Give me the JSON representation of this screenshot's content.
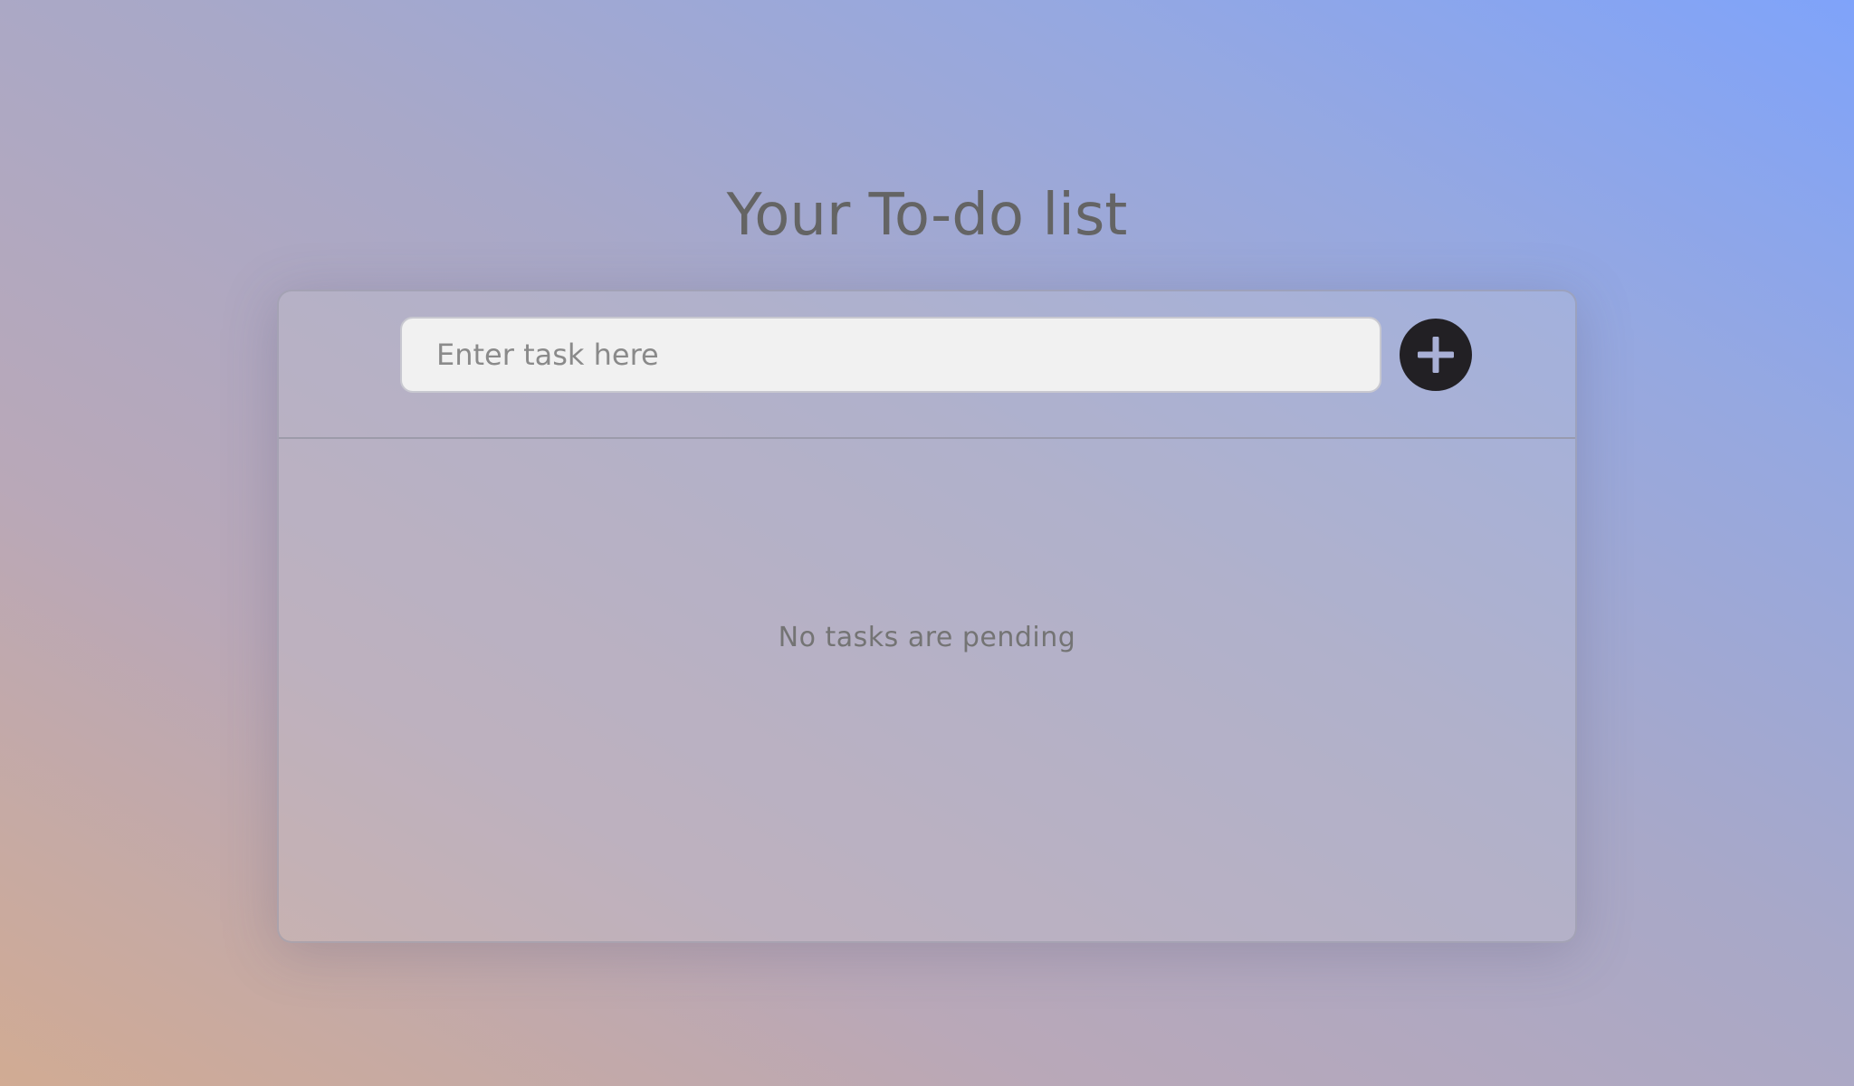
{
  "page": {
    "title": "Your To-do list"
  },
  "task_input": {
    "placeholder": "Enter task here",
    "value": ""
  },
  "add_button": {
    "icon": "plus-icon",
    "icon_color": "#a9b0d6",
    "background": "#222024"
  },
  "task_list": {
    "items": [],
    "empty_message": "No tasks are pending"
  }
}
